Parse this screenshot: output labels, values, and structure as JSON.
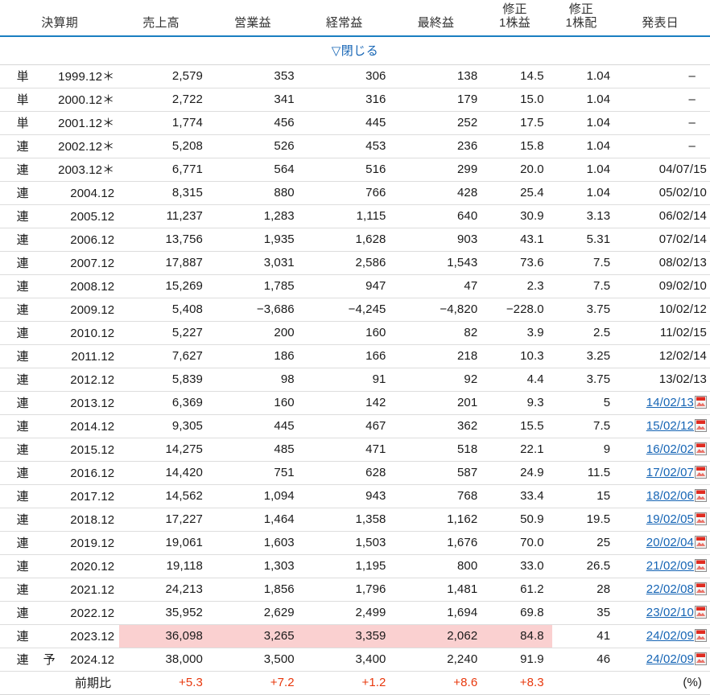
{
  "table": {
    "headers": [
      {
        "id": "kessan",
        "label": "決算期"
      },
      {
        "id": "sales",
        "label": "売上高"
      },
      {
        "id": "op",
        "label": "営業益"
      },
      {
        "id": "ord",
        "label": "経常益"
      },
      {
        "id": "net",
        "label": "最終益"
      },
      {
        "id": "eps",
        "line1": "修正",
        "line2": "1株益"
      },
      {
        "id": "dps",
        "line1": "修正",
        "line2": "1株配"
      },
      {
        "id": "date",
        "label": "発表日"
      }
    ],
    "toggle": {
      "label": "▽閉じる",
      "triangle": "▽",
      "text": "閉じる"
    },
    "rows": [
      {
        "kind": "単",
        "yoso": "",
        "term": "1999.12",
        "ast": "＊",
        "sales": "2,579",
        "op": "353",
        "ord": "306",
        "net": "138",
        "eps": "14.5",
        "dps": "1.04",
        "date": "–",
        "date_link": false
      },
      {
        "kind": "単",
        "yoso": "",
        "term": "2000.12",
        "ast": "＊",
        "sales": "2,722",
        "op": "341",
        "ord": "316",
        "net": "179",
        "eps": "15.0",
        "dps": "1.04",
        "date": "–",
        "date_link": false
      },
      {
        "kind": "単",
        "yoso": "",
        "term": "2001.12",
        "ast": "＊",
        "sales": "1,774",
        "op": "456",
        "ord": "445",
        "net": "252",
        "eps": "17.5",
        "dps": "1.04",
        "date": "–",
        "date_link": false
      },
      {
        "kind": "連",
        "yoso": "",
        "term": "2002.12",
        "ast": "＊",
        "sales": "5,208",
        "op": "526",
        "ord": "453",
        "net": "236",
        "eps": "15.8",
        "dps": "1.04",
        "date": "–",
        "date_link": false
      },
      {
        "kind": "連",
        "yoso": "",
        "term": "2003.12",
        "ast": "＊",
        "sales": "6,771",
        "op": "564",
        "ord": "516",
        "net": "299",
        "eps": "20.0",
        "dps": "1.04",
        "date": "04/07/15",
        "date_link": false
      },
      {
        "kind": "連",
        "yoso": "",
        "term": "2004.12",
        "ast": "",
        "sales": "8,315",
        "op": "880",
        "ord": "766",
        "net": "428",
        "eps": "25.4",
        "dps": "1.04",
        "date": "05/02/10",
        "date_link": false
      },
      {
        "kind": "連",
        "yoso": "",
        "term": "2005.12",
        "ast": "",
        "sales": "11,237",
        "op": "1,283",
        "ord": "1,115",
        "net": "640",
        "eps": "30.9",
        "dps": "3.13",
        "date": "06/02/14",
        "date_link": false
      },
      {
        "kind": "連",
        "yoso": "",
        "term": "2006.12",
        "ast": "",
        "sales": "13,756",
        "op": "1,935",
        "ord": "1,628",
        "net": "903",
        "eps": "43.1",
        "dps": "5.31",
        "date": "07/02/14",
        "date_link": false
      },
      {
        "kind": "連",
        "yoso": "",
        "term": "2007.12",
        "ast": "",
        "sales": "17,887",
        "op": "3,031",
        "ord": "2,586",
        "net": "1,543",
        "eps": "73.6",
        "dps": "7.5",
        "date": "08/02/13",
        "date_link": false
      },
      {
        "kind": "連",
        "yoso": "",
        "term": "2008.12",
        "ast": "",
        "sales": "15,269",
        "op": "1,785",
        "ord": "947",
        "net": "47",
        "eps": "2.3",
        "dps": "7.5",
        "date": "09/02/10",
        "date_link": false
      },
      {
        "kind": "連",
        "yoso": "",
        "term": "2009.12",
        "ast": "",
        "sales": "5,408",
        "op": "−3,686",
        "ord": "−4,245",
        "net": "−4,820",
        "eps": "−228.0",
        "dps": "3.75",
        "date": "10/02/12",
        "date_link": false
      },
      {
        "kind": "連",
        "yoso": "",
        "term": "2010.12",
        "ast": "",
        "sales": "5,227",
        "op": "200",
        "ord": "160",
        "net": "82",
        "eps": "3.9",
        "dps": "2.5",
        "date": "11/02/15",
        "date_link": false
      },
      {
        "kind": "連",
        "yoso": "",
        "term": "2011.12",
        "ast": "",
        "sales": "7,627",
        "op": "186",
        "ord": "166",
        "net": "218",
        "eps": "10.3",
        "dps": "3.25",
        "date": "12/02/14",
        "date_link": false
      },
      {
        "kind": "連",
        "yoso": "",
        "term": "2012.12",
        "ast": "",
        "sales": "5,839",
        "op": "98",
        "ord": "91",
        "net": "92",
        "eps": "4.4",
        "dps": "3.75",
        "date": "13/02/13",
        "date_link": false
      },
      {
        "kind": "連",
        "yoso": "",
        "term": "2013.12",
        "ast": "",
        "sales": "6,369",
        "op": "160",
        "ord": "142",
        "net": "201",
        "eps": "9.3",
        "dps": "5",
        "date": "14/02/13",
        "date_link": true
      },
      {
        "kind": "連",
        "yoso": "",
        "term": "2014.12",
        "ast": "",
        "sales": "9,305",
        "op": "445",
        "ord": "467",
        "net": "362",
        "eps": "15.5",
        "dps": "7.5",
        "date": "15/02/12",
        "date_link": true
      },
      {
        "kind": "連",
        "yoso": "",
        "term": "2015.12",
        "ast": "",
        "sales": "14,275",
        "op": "485",
        "ord": "471",
        "net": "518",
        "eps": "22.1",
        "dps": "9",
        "date": "16/02/02",
        "date_link": true
      },
      {
        "kind": "連",
        "yoso": "",
        "term": "2016.12",
        "ast": "",
        "sales": "14,420",
        "op": "751",
        "ord": "628",
        "net": "587",
        "eps": "24.9",
        "dps": "11.5",
        "date": "17/02/07",
        "date_link": true
      },
      {
        "kind": "連",
        "yoso": "",
        "term": "2017.12",
        "ast": "",
        "sales": "14,562",
        "op": "1,094",
        "ord": "943",
        "net": "768",
        "eps": "33.4",
        "dps": "15",
        "date": "18/02/06",
        "date_link": true
      },
      {
        "kind": "連",
        "yoso": "",
        "term": "2018.12",
        "ast": "",
        "sales": "17,227",
        "op": "1,464",
        "ord": "1,358",
        "net": "1,162",
        "eps": "50.9",
        "dps": "19.5",
        "date": "19/02/05",
        "date_link": true
      },
      {
        "kind": "連",
        "yoso": "",
        "term": "2019.12",
        "ast": "",
        "sales": "19,061",
        "op": "1,603",
        "ord": "1,503",
        "net": "1,676",
        "eps": "70.0",
        "dps": "25",
        "date": "20/02/04",
        "date_link": true
      },
      {
        "kind": "連",
        "yoso": "",
        "term": "2020.12",
        "ast": "",
        "sales": "19,118",
        "op": "1,303",
        "ord": "1,195",
        "net": "800",
        "eps": "33.0",
        "dps": "26.5",
        "date": "21/02/09",
        "date_link": true
      },
      {
        "kind": "連",
        "yoso": "",
        "term": "2021.12",
        "ast": "",
        "sales": "24,213",
        "op": "1,856",
        "ord": "1,796",
        "net": "1,481",
        "eps": "61.2",
        "dps": "28",
        "date": "22/02/08",
        "date_link": true
      },
      {
        "kind": "連",
        "yoso": "",
        "term": "2022.12",
        "ast": "",
        "sales": "35,952",
        "op": "2,629",
        "ord": "2,499",
        "net": "1,694",
        "eps": "69.8",
        "dps": "35",
        "date": "23/02/10",
        "date_link": true
      },
      {
        "kind": "連",
        "yoso": "",
        "term": "2023.12",
        "ast": "",
        "sales": "36,098",
        "op": "3,265",
        "ord": "3,359",
        "net": "2,062",
        "eps": "84.8",
        "dps": "41",
        "date": "24/02/09",
        "date_link": true,
        "highlight": true
      },
      {
        "kind": "連",
        "yoso": "予",
        "term": "2024.12",
        "ast": "",
        "sales": "38,000",
        "op": "3,500",
        "ord": "3,400",
        "net": "2,240",
        "eps": "91.9",
        "dps": "46",
        "date": "24/02/09",
        "date_link": true,
        "forecast": true
      }
    ],
    "compare_row": {
      "label": "前期比",
      "sales": "+5.3",
      "op": "+7.2",
      "ord": "+1.2",
      "net": "+8.6",
      "eps": "+8.3",
      "dps": "",
      "unit": "(%)"
    }
  },
  "colors": {
    "header_rule": "#1a7fc1",
    "link": "#1665b5",
    "highlight": "#fad0d0",
    "positive": "#e8380d",
    "row_border": "#dddddd"
  },
  "icons": {
    "pdf": "pdf-icon"
  }
}
